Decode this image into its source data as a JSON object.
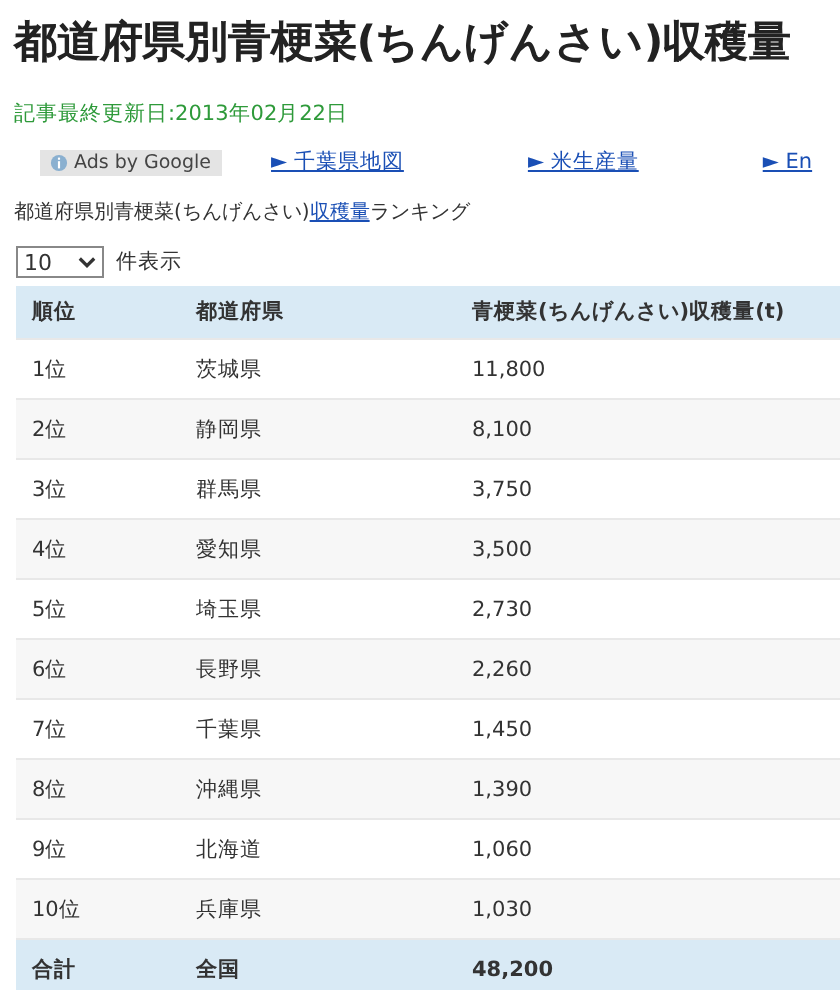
{
  "title": "都道府県別青梗菜(ちんげんさい)収穫量",
  "updated": "記事最終更新日:2013年02月22日",
  "ads": {
    "label": "Ads by Google",
    "links": [
      "► 千葉県地図",
      "► 米生産量",
      "► En"
    ]
  },
  "intro": {
    "before": "都道府県別青梗菜(ちんげんさい)",
    "link": "収穫量",
    "after": "ランキング"
  },
  "page_size": {
    "value": "10",
    "label": "件表示"
  },
  "table": {
    "columns": [
      "順位",
      "都道府県",
      "青梗菜(ちんげんさい)収穫量(t)"
    ],
    "rows": [
      [
        "1位",
        "茨城県",
        "11,800"
      ],
      [
        "2位",
        "静岡県",
        "8,100"
      ],
      [
        "3位",
        "群馬県",
        "3,750"
      ],
      [
        "4位",
        "愛知県",
        "3,500"
      ],
      [
        "5位",
        "埼玉県",
        "2,730"
      ],
      [
        "6位",
        "長野県",
        "2,260"
      ],
      [
        "7位",
        "千葉県",
        "1,450"
      ],
      [
        "8位",
        "沖縄県",
        "1,390"
      ],
      [
        "9位",
        "北海道",
        "1,060"
      ],
      [
        "10位",
        "兵庫県",
        "1,030"
      ]
    ],
    "footer": [
      "合計",
      "全国",
      "48,200"
    ]
  }
}
